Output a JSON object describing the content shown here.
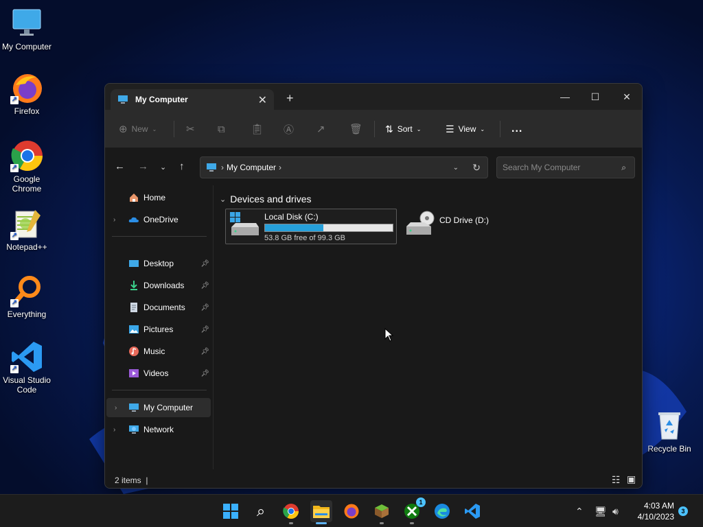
{
  "desktop": {
    "icons": [
      {
        "label": "My Computer"
      },
      {
        "label": "Firefox"
      },
      {
        "label": "Google Chrome"
      },
      {
        "label": "Notepad++"
      },
      {
        "label": "Everything"
      },
      {
        "label": "Visual Studio Code"
      },
      {
        "label": "Recycle Bin"
      }
    ]
  },
  "window": {
    "tab_title": "My Computer",
    "toolbar": {
      "new_label": "New",
      "sort_label": "Sort",
      "view_label": "View",
      "more_label": "..."
    },
    "address": {
      "breadcrumb": "My Computer",
      "search_placeholder": "Search My Computer"
    },
    "sidebar": {
      "items": [
        {
          "label": "Home"
        },
        {
          "label": "OneDrive"
        },
        {
          "label": "Desktop"
        },
        {
          "label": "Downloads"
        },
        {
          "label": "Documents"
        },
        {
          "label": "Pictures"
        },
        {
          "label": "Music"
        },
        {
          "label": "Videos"
        },
        {
          "label": "My Computer"
        },
        {
          "label": "Network"
        }
      ]
    },
    "content": {
      "group_header": "Devices and drives",
      "drives": [
        {
          "name": "Local Disk (C:)",
          "free_text": "53.8 GB free of 99.3 GB",
          "used_fraction": 0.458
        },
        {
          "name": "CD Drive (D:)"
        }
      ]
    },
    "status": {
      "items_text": "2 items"
    }
  },
  "taskbar": {
    "xbox_badge": "1",
    "time": "4:03 AM",
    "date": "4/10/2023",
    "notification_count": "3"
  },
  "colors": {
    "accent": "#26a0da",
    "badge": "#4cc2ff",
    "window_bg": "#191919",
    "toolbar_bg": "#2b2b2b"
  }
}
